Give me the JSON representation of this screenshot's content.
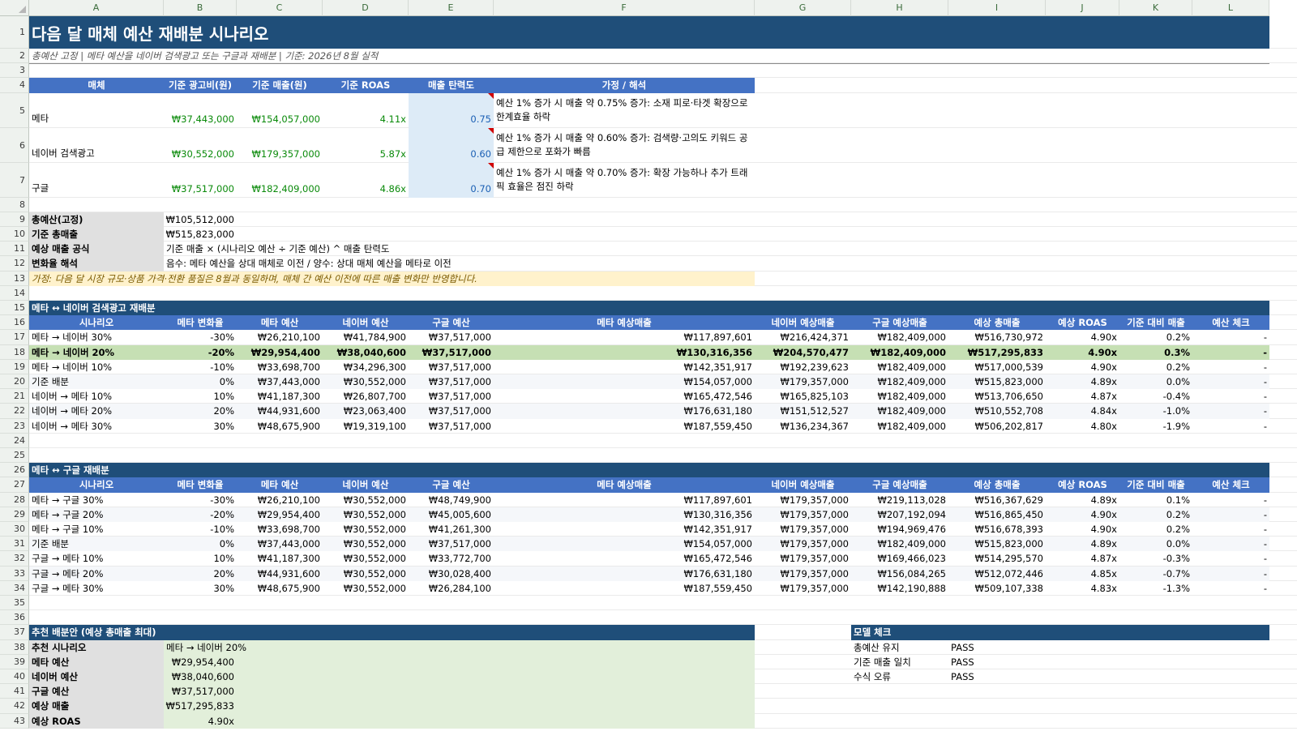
{
  "columns": [
    "A",
    "B",
    "C",
    "D",
    "E",
    "F",
    "G",
    "H",
    "I",
    "J",
    "K",
    "L"
  ],
  "title": "다음 달 매체 예산 재배분 시나리오",
  "subtitle": "총예산 고정 | 메타 예산을 네이버 검색광고 또는 구글과 재배분 | 기준: 2026년 8월 실적",
  "baseline": {
    "headers": [
      "매체",
      "기준 광고비(원)",
      "기준 매출(원)",
      "기준 ROAS",
      "매출 탄력도",
      "가정 / 해석"
    ],
    "rows": [
      {
        "media": "메타",
        "spend": "₩37,443,000",
        "revenue": "₩154,057,000",
        "roas": "4.11x",
        "elasticity": "0.75",
        "note": "예산 1% 증가 시 매출 약 0.75% 증가: 소재 피로·타겟 확장으로 한계효율 하락"
      },
      {
        "media": "네이버 검색광고",
        "spend": "₩30,552,000",
        "revenue": "₩179,357,000",
        "roas": "5.87x",
        "elasticity": "0.60",
        "note": "예산 1% 증가 시 매출 약 0.60% 증가: 검색량·고의도 키워드 공급 제한으로 포화가 빠름"
      },
      {
        "media": "구글",
        "spend": "₩37,517,000",
        "revenue": "₩182,409,000",
        "roas": "4.86x",
        "elasticity": "0.70",
        "note": "예산 1% 증가 시 매출 약 0.70% 증가: 확장 가능하나 추가 트래픽 효율은 점진 하락"
      }
    ]
  },
  "info": [
    {
      "label": "총예산(고정)",
      "value": "₩105,512,000"
    },
    {
      "label": "기준 총매출",
      "value": "₩515,823,000"
    },
    {
      "label": "예상 매출 공식",
      "value": "기준 매출 × (시나리오 예산 ÷ 기준 예산) ^ 매출 탄력도"
    },
    {
      "label": "변화율 해석",
      "value": "음수: 메타 예산을 상대 매체로 이전 / 양수: 상대 매체 예산을 메타로 이전"
    }
  ],
  "assumption": "가정: 다음 달 시장 규모·상품 가격·전환 품질은 8월과 동일하며, 매체 간 예산 이전에 따른 매출 변화만 반영합니다.",
  "scenario_headers": [
    "시나리오",
    "메타 변화율",
    "메타 예산",
    "네이버 예산",
    "구글 예산",
    "메타 예상매출",
    "네이버 예상매출",
    "구글 예상매출",
    "예상 총매출",
    "예상 ROAS",
    "기준 대비 매출",
    "예산 체크"
  ],
  "section1": {
    "title": "메타 ↔ 네이버 검색광고 재배분",
    "rows": [
      [
        "메타 → 네이버 30%",
        "-30%",
        "₩26,210,100",
        "₩41,784,900",
        "₩37,517,000",
        "₩117,897,601",
        "₩216,424,371",
        "₩182,409,000",
        "₩516,730,972",
        "4.90x",
        "0.2%",
        "-"
      ],
      [
        "메타 → 네이버 20%",
        "-20%",
        "₩29,954,400",
        "₩38,040,600",
        "₩37,517,000",
        "₩130,316,356",
        "₩204,570,477",
        "₩182,409,000",
        "₩517,295,833",
        "4.90x",
        "0.3%",
        "-"
      ],
      [
        "메타 → 네이버 10%",
        "-10%",
        "₩33,698,700",
        "₩34,296,300",
        "₩37,517,000",
        "₩142,351,917",
        "₩192,239,623",
        "₩182,409,000",
        "₩517,000,539",
        "4.90x",
        "0.2%",
        "-"
      ],
      [
        "기준 배분",
        "0%",
        "₩37,443,000",
        "₩30,552,000",
        "₩37,517,000",
        "₩154,057,000",
        "₩179,357,000",
        "₩182,409,000",
        "₩515,823,000",
        "4.89x",
        "0.0%",
        "-"
      ],
      [
        "네이버 → 메타 10%",
        "10%",
        "₩41,187,300",
        "₩26,807,700",
        "₩37,517,000",
        "₩165,472,546",
        "₩165,825,103",
        "₩182,409,000",
        "₩513,706,650",
        "4.87x",
        "-0.4%",
        "-"
      ],
      [
        "네이버 → 메타 20%",
        "20%",
        "₩44,931,600",
        "₩23,063,400",
        "₩37,517,000",
        "₩176,631,180",
        "₩151,512,527",
        "₩182,409,000",
        "₩510,552,708",
        "4.84x",
        "-1.0%",
        "-"
      ],
      [
        "네이버 → 메타 30%",
        "30%",
        "₩48,675,900",
        "₩19,319,100",
        "₩37,517,000",
        "₩187,559,450",
        "₩136,234,367",
        "₩182,409,000",
        "₩506,202,817",
        "4.80x",
        "-1.9%",
        "-"
      ]
    ]
  },
  "section2": {
    "title": "메타 ↔ 구글 재배분",
    "rows": [
      [
        "메타 → 구글 30%",
        "-30%",
        "₩26,210,100",
        "₩30,552,000",
        "₩48,749,900",
        "₩117,897,601",
        "₩179,357,000",
        "₩219,113,028",
        "₩516,367,629",
        "4.89x",
        "0.1%",
        "-"
      ],
      [
        "메타 → 구글 20%",
        "-20%",
        "₩29,954,400",
        "₩30,552,000",
        "₩45,005,600",
        "₩130,316,356",
        "₩179,357,000",
        "₩207,192,094",
        "₩516,865,450",
        "4.90x",
        "0.2%",
        "-"
      ],
      [
        "메타 → 구글 10%",
        "-10%",
        "₩33,698,700",
        "₩30,552,000",
        "₩41,261,300",
        "₩142,351,917",
        "₩179,357,000",
        "₩194,969,476",
        "₩516,678,393",
        "4.90x",
        "0.2%",
        "-"
      ],
      [
        "기준 배분",
        "0%",
        "₩37,443,000",
        "₩30,552,000",
        "₩37,517,000",
        "₩154,057,000",
        "₩179,357,000",
        "₩182,409,000",
        "₩515,823,000",
        "4.89x",
        "0.0%",
        "-"
      ],
      [
        "구글 → 메타 10%",
        "10%",
        "₩41,187,300",
        "₩30,552,000",
        "₩33,772,700",
        "₩165,472,546",
        "₩179,357,000",
        "₩169,466,023",
        "₩514,295,570",
        "4.87x",
        "-0.3%",
        "-"
      ],
      [
        "구글 → 메타 20%",
        "20%",
        "₩44,931,600",
        "₩30,552,000",
        "₩30,028,400",
        "₩176,631,180",
        "₩179,357,000",
        "₩156,084,265",
        "₩512,072,446",
        "4.85x",
        "-0.7%",
        "-"
      ],
      [
        "구글 → 메타 30%",
        "30%",
        "₩48,675,900",
        "₩30,552,000",
        "₩26,284,100",
        "₩187,559,450",
        "₩179,357,000",
        "₩142,190,888",
        "₩509,107,338",
        "4.83x",
        "-1.3%",
        "-"
      ]
    ]
  },
  "recommend": {
    "title": "추천 배분안 (예상 총매출 최대)",
    "rows": [
      {
        "label": "추천 시나리오",
        "value": "메타 → 네이버 20%"
      },
      {
        "label": "메타 예산",
        "value": "₩29,954,400"
      },
      {
        "label": "네이버 예산",
        "value": "₩38,040,600"
      },
      {
        "label": "구글 예산",
        "value": "₩37,517,000"
      },
      {
        "label": "예상 매출",
        "value": "₩517,295,833"
      },
      {
        "label": "예상 ROAS",
        "value": "4.90x"
      }
    ]
  },
  "model_check": {
    "title": "모델 체크",
    "rows": [
      {
        "label": "총예산 유지",
        "value": "PASS"
      },
      {
        "label": "기준 매출 일치",
        "value": "PASS"
      },
      {
        "label": "수식 오류",
        "value": "PASS"
      }
    ]
  },
  "colors": {
    "navy": "#1f4e79",
    "blue": "#4472c4",
    "green_hi": "#c6e0b4",
    "light_green": "#e2efda",
    "gray": "#e0e0e0",
    "cream": "#fff2cc",
    "elasticity_bg": "#ddebf7"
  }
}
